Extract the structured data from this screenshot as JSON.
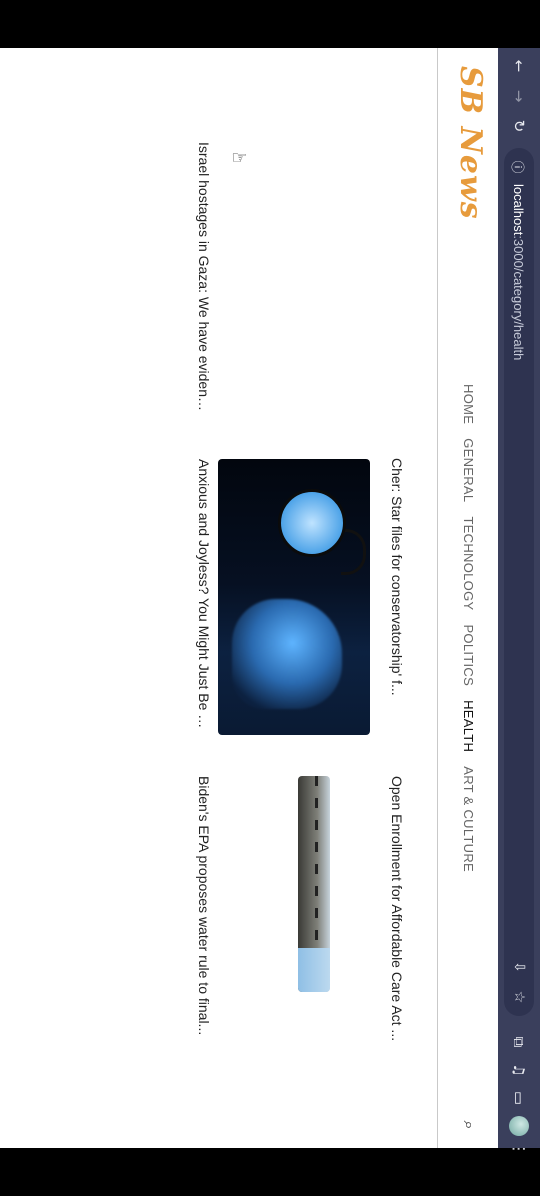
{
  "browser": {
    "url_host": "localhost",
    "url_path": ":3000/category/health"
  },
  "site": {
    "logo": "SB News",
    "nav": [
      "HOME",
      "GENERAL",
      "TECHNOLOGY",
      "POLITICS",
      "HEALTH",
      "ART & CULTURE"
    ],
    "active_nav": "HEALTH"
  },
  "articles": [
    {
      "title": "Israel hostages in Gaza: We have evidenc..."
    },
    {
      "title": "Cher: Star files for conservatorship' f..."
    },
    {
      "title": "Anxious and Joyless? You Might Just Be S..."
    },
    {
      "title": "Open Enrollment for Affordable Care Act ..."
    },
    {
      "title": "Biden's EPA proposes water rule to final..."
    }
  ]
}
